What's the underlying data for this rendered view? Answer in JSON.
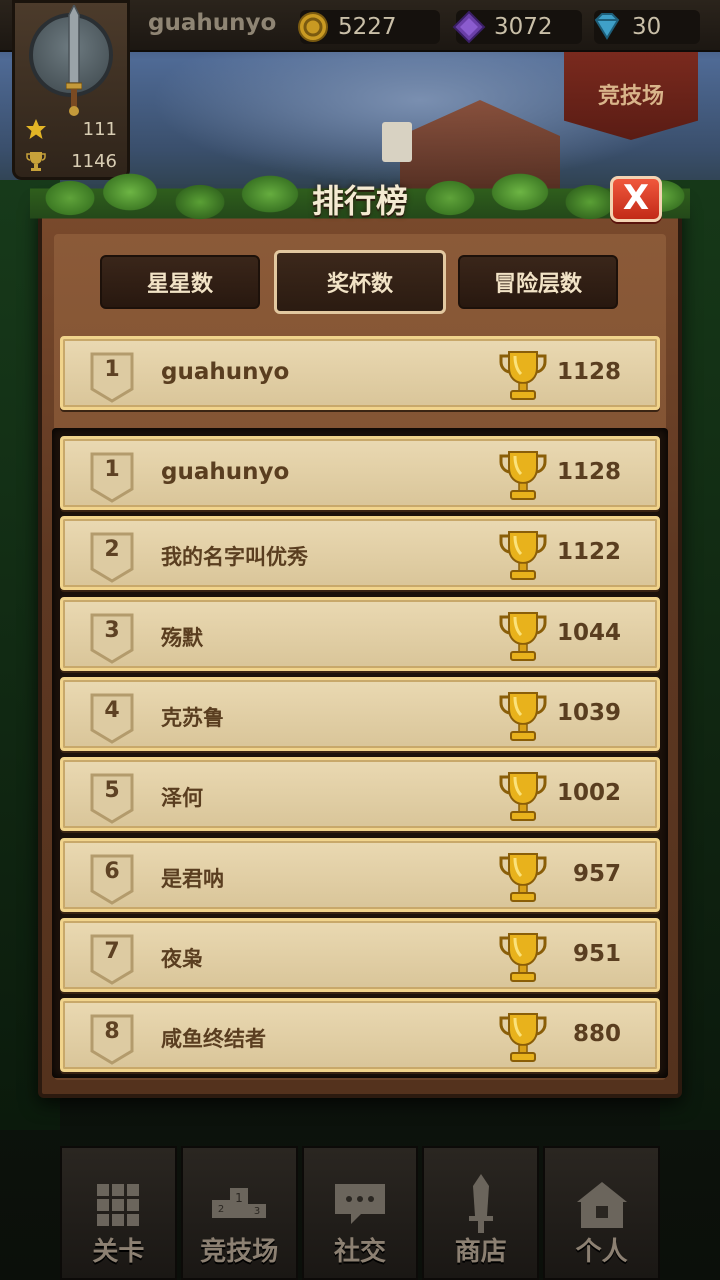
{
  "player": {
    "username": "guahunyo",
    "stars": "111",
    "trophies": "1146"
  },
  "currencies": {
    "gold": "5227",
    "gems_purple": "3072",
    "diamonds": "30"
  },
  "arena_button": "竞技场",
  "leaderboard": {
    "title": "排行榜",
    "close_label": "X",
    "tabs": [
      {
        "label": "星星数",
        "active": false
      },
      {
        "label": "奖杯数",
        "active": true
      },
      {
        "label": "冒险层数",
        "active": false
      }
    ],
    "my_rank": {
      "rank": "1",
      "name": "guahunyo",
      "score": "1128"
    },
    "entries": [
      {
        "rank": "1",
        "name": "guahunyo",
        "score": "1128"
      },
      {
        "rank": "2",
        "name": "我的名字叫优秀",
        "score": "1122"
      },
      {
        "rank": "3",
        "name": "殇默",
        "score": "1044"
      },
      {
        "rank": "4",
        "name": "克苏鲁",
        "score": "1039"
      },
      {
        "rank": "5",
        "name": "泽何",
        "score": "1002"
      },
      {
        "rank": "6",
        "name": "是君呐",
        "score": "957"
      },
      {
        "rank": "7",
        "name": "夜枭",
        "score": "951"
      },
      {
        "rank": "8",
        "name": "咸鱼终结者",
        "score": "880"
      }
    ]
  },
  "bottom_nav": [
    {
      "label": "关卡",
      "icon": "grid-icon"
    },
    {
      "label": "竞技场",
      "icon": "podium-icon"
    },
    {
      "label": "社交",
      "icon": "chat-icon"
    },
    {
      "label": "商店",
      "icon": "sword-icon"
    },
    {
      "label": "个人",
      "icon": "house-icon"
    }
  ],
  "colors": {
    "row_bg": "#e2cfa5",
    "row_text": "#5a3e20",
    "close_button": "#d83a22",
    "trophy_gold": "#e8b21c"
  }
}
